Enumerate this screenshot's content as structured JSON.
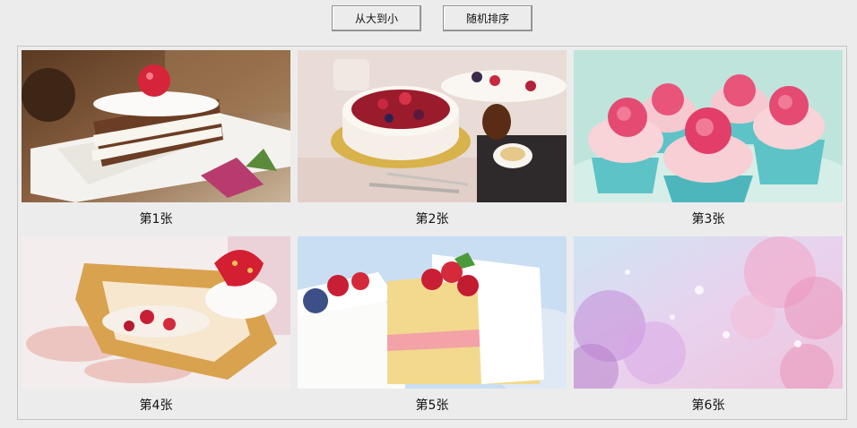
{
  "toolbar": {
    "sort_label": "从大到小",
    "random_label": "随机排序"
  },
  "gallery": {
    "items": [
      {
        "caption": "第1张"
      },
      {
        "caption": "第2张"
      },
      {
        "caption": "第3张"
      },
      {
        "caption": "第4张"
      },
      {
        "caption": "第5张"
      },
      {
        "caption": "第6张"
      }
    ]
  }
}
